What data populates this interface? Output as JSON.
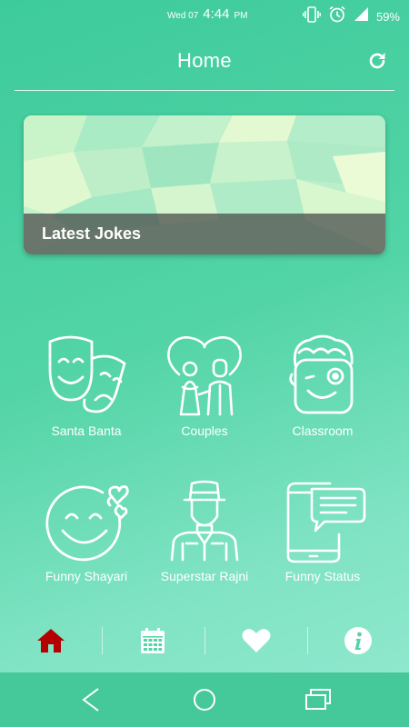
{
  "status_bar": {
    "date": "Wed 07",
    "time": "4:44",
    "ampm": "PM",
    "battery": "59%"
  },
  "header": {
    "title": "Home",
    "refresh_icon": "refresh-icon"
  },
  "banner": {
    "label": "Latest Jokes"
  },
  "categories": [
    {
      "label": "Santa Banta",
      "icon": "theater-masks-icon"
    },
    {
      "label": "Couples",
      "icon": "couple-heart-icon"
    },
    {
      "label": "Classroom",
      "icon": "winking-face-icon"
    },
    {
      "label": "Funny Shayari",
      "icon": "smiley-heart-icon"
    },
    {
      "label": "Superstar Rajni",
      "icon": "man-with-hat-icon"
    },
    {
      "label": "Funny Status",
      "icon": "phone-message-icon"
    }
  ],
  "tabs": [
    {
      "icon": "home-icon",
      "active": true
    },
    {
      "icon": "calendar-icon",
      "active": false
    },
    {
      "icon": "heart-icon",
      "active": false
    },
    {
      "icon": "info-icon",
      "active": false
    }
  ],
  "colors": {
    "background": "#52d4a6",
    "active_tab": "#b30000",
    "nav_bar": "#45c99a"
  }
}
